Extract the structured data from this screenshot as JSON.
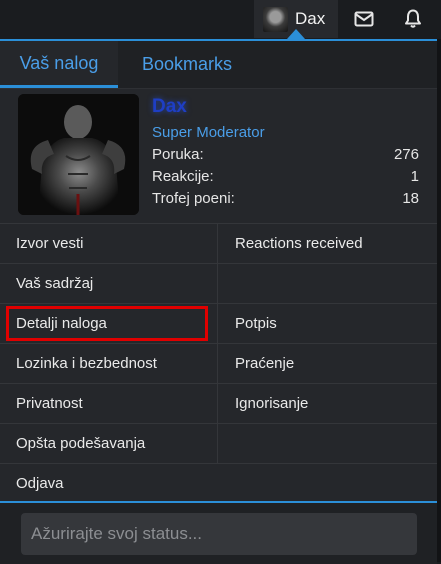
{
  "topbar": {
    "username": "Dax",
    "icons": [
      "avatar",
      "mail-icon",
      "bell-icon"
    ]
  },
  "tabs": [
    {
      "label": "Vaš nalog",
      "active": true
    },
    {
      "label": "Bookmarks",
      "active": false
    }
  ],
  "profile": {
    "name": "Dax",
    "role": "Super Moderator",
    "stats": [
      {
        "label": "Poruka:",
        "value": "276"
      },
      {
        "label": "Reakcije:",
        "value": "1"
      },
      {
        "label": "Trofej poeni:",
        "value": "18"
      }
    ]
  },
  "menu": {
    "rows": [
      {
        "left": "Izvor vesti",
        "right": "Reactions received"
      },
      {
        "left": "Vaš sadržaj",
        "right": ""
      },
      {
        "left": "Detalji naloga",
        "right": "Potpis"
      },
      {
        "left": "Lozinka i bezbednost",
        "right": "Praćenje"
      },
      {
        "left": "Privatnost",
        "right": "Ignorisanje"
      },
      {
        "left": "Opšta podešavanja",
        "right": ""
      }
    ],
    "logout": "Odjava"
  },
  "status": {
    "placeholder": "Ažurirajte svoj status..."
  },
  "colors": {
    "accent": "#2b8fd8",
    "link": "#4a9ee8",
    "username_color": "#1e3ec4",
    "highlight": "#e00000",
    "panel_bg": "#25272b"
  }
}
